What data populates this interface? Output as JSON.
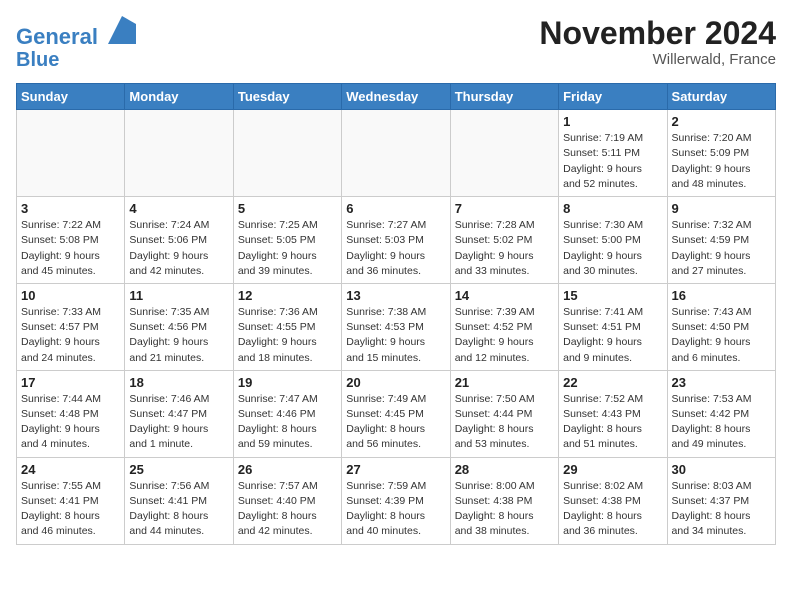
{
  "header": {
    "logo_line1": "General",
    "logo_line2": "Blue",
    "month": "November 2024",
    "location": "Willerwald, France"
  },
  "weekdays": [
    "Sunday",
    "Monday",
    "Tuesday",
    "Wednesday",
    "Thursday",
    "Friday",
    "Saturday"
  ],
  "weeks": [
    [
      {
        "day": "",
        "info": ""
      },
      {
        "day": "",
        "info": ""
      },
      {
        "day": "",
        "info": ""
      },
      {
        "day": "",
        "info": ""
      },
      {
        "day": "",
        "info": ""
      },
      {
        "day": "1",
        "info": "Sunrise: 7:19 AM\nSunset: 5:11 PM\nDaylight: 9 hours\nand 52 minutes."
      },
      {
        "day": "2",
        "info": "Sunrise: 7:20 AM\nSunset: 5:09 PM\nDaylight: 9 hours\nand 48 minutes."
      }
    ],
    [
      {
        "day": "3",
        "info": "Sunrise: 7:22 AM\nSunset: 5:08 PM\nDaylight: 9 hours\nand 45 minutes."
      },
      {
        "day": "4",
        "info": "Sunrise: 7:24 AM\nSunset: 5:06 PM\nDaylight: 9 hours\nand 42 minutes."
      },
      {
        "day": "5",
        "info": "Sunrise: 7:25 AM\nSunset: 5:05 PM\nDaylight: 9 hours\nand 39 minutes."
      },
      {
        "day": "6",
        "info": "Sunrise: 7:27 AM\nSunset: 5:03 PM\nDaylight: 9 hours\nand 36 minutes."
      },
      {
        "day": "7",
        "info": "Sunrise: 7:28 AM\nSunset: 5:02 PM\nDaylight: 9 hours\nand 33 minutes."
      },
      {
        "day": "8",
        "info": "Sunrise: 7:30 AM\nSunset: 5:00 PM\nDaylight: 9 hours\nand 30 minutes."
      },
      {
        "day": "9",
        "info": "Sunrise: 7:32 AM\nSunset: 4:59 PM\nDaylight: 9 hours\nand 27 minutes."
      }
    ],
    [
      {
        "day": "10",
        "info": "Sunrise: 7:33 AM\nSunset: 4:57 PM\nDaylight: 9 hours\nand 24 minutes."
      },
      {
        "day": "11",
        "info": "Sunrise: 7:35 AM\nSunset: 4:56 PM\nDaylight: 9 hours\nand 21 minutes."
      },
      {
        "day": "12",
        "info": "Sunrise: 7:36 AM\nSunset: 4:55 PM\nDaylight: 9 hours\nand 18 minutes."
      },
      {
        "day": "13",
        "info": "Sunrise: 7:38 AM\nSunset: 4:53 PM\nDaylight: 9 hours\nand 15 minutes."
      },
      {
        "day": "14",
        "info": "Sunrise: 7:39 AM\nSunset: 4:52 PM\nDaylight: 9 hours\nand 12 minutes."
      },
      {
        "day": "15",
        "info": "Sunrise: 7:41 AM\nSunset: 4:51 PM\nDaylight: 9 hours\nand 9 minutes."
      },
      {
        "day": "16",
        "info": "Sunrise: 7:43 AM\nSunset: 4:50 PM\nDaylight: 9 hours\nand 6 minutes."
      }
    ],
    [
      {
        "day": "17",
        "info": "Sunrise: 7:44 AM\nSunset: 4:48 PM\nDaylight: 9 hours\nand 4 minutes."
      },
      {
        "day": "18",
        "info": "Sunrise: 7:46 AM\nSunset: 4:47 PM\nDaylight: 9 hours\nand 1 minute."
      },
      {
        "day": "19",
        "info": "Sunrise: 7:47 AM\nSunset: 4:46 PM\nDaylight: 8 hours\nand 59 minutes."
      },
      {
        "day": "20",
        "info": "Sunrise: 7:49 AM\nSunset: 4:45 PM\nDaylight: 8 hours\nand 56 minutes."
      },
      {
        "day": "21",
        "info": "Sunrise: 7:50 AM\nSunset: 4:44 PM\nDaylight: 8 hours\nand 53 minutes."
      },
      {
        "day": "22",
        "info": "Sunrise: 7:52 AM\nSunset: 4:43 PM\nDaylight: 8 hours\nand 51 minutes."
      },
      {
        "day": "23",
        "info": "Sunrise: 7:53 AM\nSunset: 4:42 PM\nDaylight: 8 hours\nand 49 minutes."
      }
    ],
    [
      {
        "day": "24",
        "info": "Sunrise: 7:55 AM\nSunset: 4:41 PM\nDaylight: 8 hours\nand 46 minutes."
      },
      {
        "day": "25",
        "info": "Sunrise: 7:56 AM\nSunset: 4:41 PM\nDaylight: 8 hours\nand 44 minutes."
      },
      {
        "day": "26",
        "info": "Sunrise: 7:57 AM\nSunset: 4:40 PM\nDaylight: 8 hours\nand 42 minutes."
      },
      {
        "day": "27",
        "info": "Sunrise: 7:59 AM\nSunset: 4:39 PM\nDaylight: 8 hours\nand 40 minutes."
      },
      {
        "day": "28",
        "info": "Sunrise: 8:00 AM\nSunset: 4:38 PM\nDaylight: 8 hours\nand 38 minutes."
      },
      {
        "day": "29",
        "info": "Sunrise: 8:02 AM\nSunset: 4:38 PM\nDaylight: 8 hours\nand 36 minutes."
      },
      {
        "day": "30",
        "info": "Sunrise: 8:03 AM\nSunset: 4:37 PM\nDaylight: 8 hours\nand 34 minutes."
      }
    ]
  ]
}
